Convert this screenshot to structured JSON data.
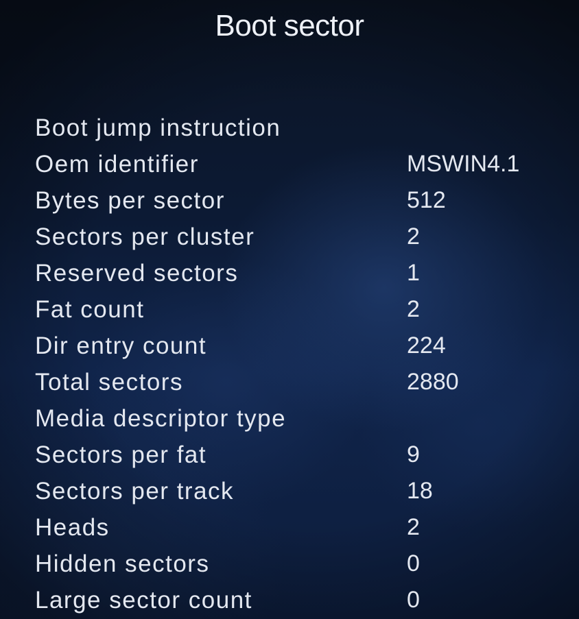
{
  "title": "Boot sector",
  "fields": [
    {
      "label": "Boot jump instruction",
      "value": ""
    },
    {
      "label": "Oem identifier",
      "value": "MSWIN4.1"
    },
    {
      "label": "Bytes per sector",
      "value": "512"
    },
    {
      "label": "Sectors per cluster",
      "value": "2"
    },
    {
      "label": "Reserved sectors",
      "value": "1"
    },
    {
      "label": "Fat count",
      "value": "2"
    },
    {
      "label": "Dir entry count",
      "value": "224"
    },
    {
      "label": "Total sectors",
      "value": "2880"
    },
    {
      "label": "Media descriptor type",
      "value": ""
    },
    {
      "label": "Sectors per fat",
      "value": "9"
    },
    {
      "label": "Sectors per track",
      "value": "18"
    },
    {
      "label": "Heads",
      "value": "2"
    },
    {
      "label": "Hidden sectors",
      "value": "0"
    },
    {
      "label": "Large sector count",
      "value": "0"
    }
  ]
}
